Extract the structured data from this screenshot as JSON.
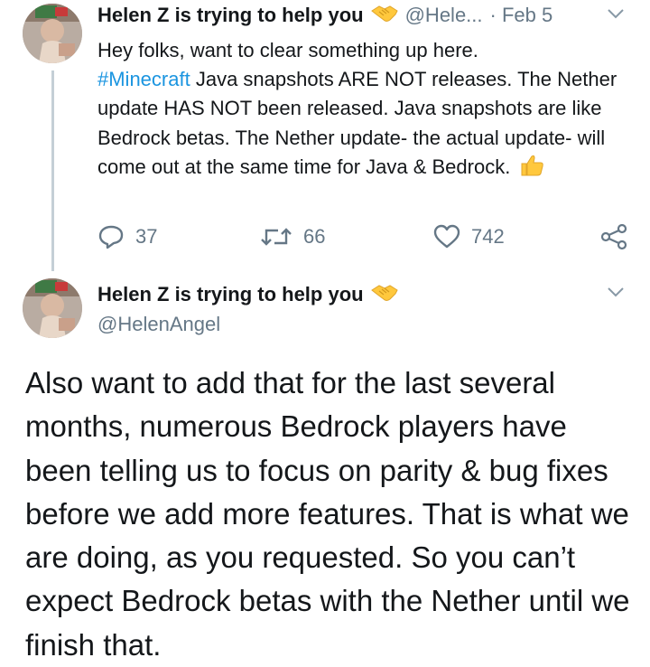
{
  "tweet1": {
    "display_name": "Helen Z is trying to help you",
    "handle": "@Hele...",
    "date": "· Feb 5",
    "text_before_hashtag": "Hey folks, want to clear something up here.",
    "hashtag": "#Minecraft",
    "text_after_hashtag": " Java snapshots ARE NOT releases. The Nether update HAS NOT been released. Java snapshots are like Bedrock betas. The Nether update- the actual update- will come out at the same time for Java & Bedrock.",
    "reply_count": "37",
    "retweet_count": "66",
    "like_count": "742"
  },
  "tweet2": {
    "display_name": "Helen Z is trying to help you",
    "handle": "@HelenAngel",
    "text": "Also want to add that for the last several months, numerous Bedrock players have been telling us to focus on parity & bug fixes before we add more features. That is what we are doing, as you requested. So you can’t expect Bedrock betas with the Nether until we finish that."
  },
  "icons": {
    "emoji_name": "handshake",
    "emoji_text": "thumbs-up",
    "reply": "reply-icon",
    "retweet": "retweet-icon",
    "like": "heart-icon",
    "share": "share-icon",
    "more": "chevron-down-icon"
  },
  "colors": {
    "link": "#1b95e0",
    "secondary_text": "#657786",
    "primary_text": "#14171a",
    "thread_line": "#c4cfd6",
    "emoji": "#ffc83d"
  }
}
